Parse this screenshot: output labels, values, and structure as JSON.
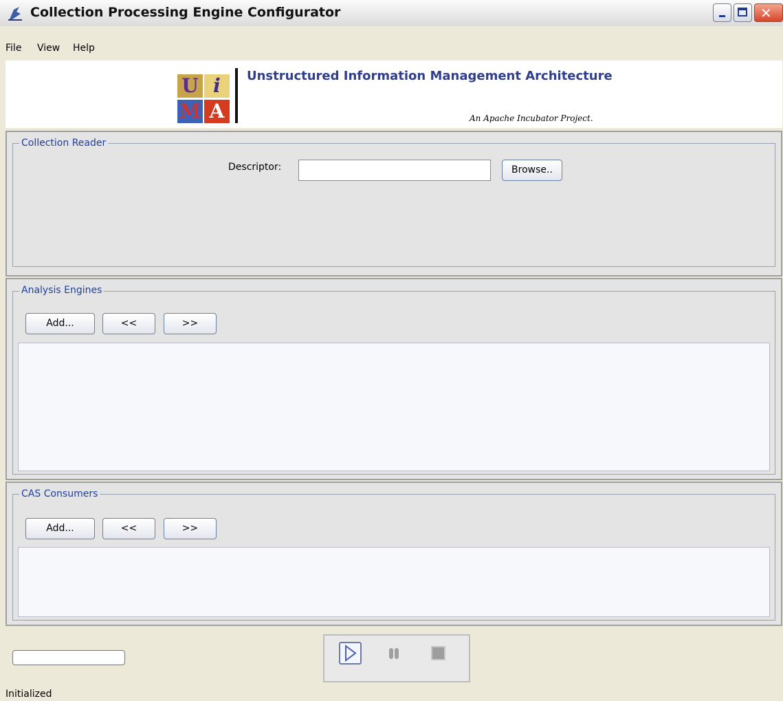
{
  "window": {
    "title": "Collection Processing Engine Configurator",
    "close_glyph": "✕"
  },
  "menu": {
    "items": [
      "File",
      "View",
      "Help"
    ]
  },
  "banner": {
    "logo_letters": [
      "U",
      "i",
      "M",
      "A"
    ],
    "title": "Unstructured Information Management Architecture",
    "subtitle": "An Apache Incubator Project."
  },
  "collection_reader": {
    "label": "Collection Reader",
    "descriptor_label": "Descriptor:",
    "descriptor_value": "",
    "browse_label": "Browse.."
  },
  "analysis_engines": {
    "label": "Analysis Engines",
    "add_label": "Add...",
    "move_left_label": "<<",
    "move_right_label": ">>"
  },
  "cas_consumers": {
    "label": "CAS Consumers",
    "add_label": "Add...",
    "move_left_label": "<<",
    "move_right_label": ">>"
  },
  "controls": {
    "play_icon": "play-icon",
    "pause_icon": "pause-icon",
    "stop_icon": "stop-icon"
  },
  "status": {
    "text": "Initialized"
  },
  "colors": {
    "group_label": "#1f3f9d",
    "banner_title": "#2f3f8c"
  }
}
